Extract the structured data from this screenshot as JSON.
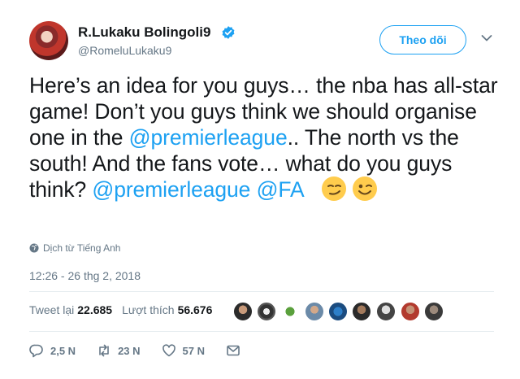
{
  "user": {
    "display_name": "R.Lukaku Bolingoli9",
    "handle": "@RomeluLukaku9",
    "verified": true
  },
  "follow_button_label": "Theo dõi",
  "tweet": {
    "segments": [
      {
        "text": "Here’s an idea for you guys… the nba has all-star game! Don’t you guys think we should organise one in the ",
        "type": "text"
      },
      {
        "text": "@premierleague",
        "type": "mention"
      },
      {
        "text": "..  The north vs the south! And the fans vote… what do you guys think? ",
        "type": "text"
      },
      {
        "text": "@premierleague",
        "type": "mention"
      },
      {
        "text": " ",
        "type": "text"
      },
      {
        "text": "@FA",
        "type": "mention"
      }
    ],
    "emojis": [
      "smirking-face-emoji",
      "winking-face-emoji"
    ]
  },
  "translate_label": "Dịch từ Tiếng Anh",
  "timestamp": "12:26 - 26 thg 2, 2018",
  "stats": {
    "retweets_label": "Tweet lại",
    "retweets_count": "22.685",
    "likes_label": "Lượt thích",
    "likes_count": "56.676"
  },
  "likers_count": 9,
  "actions": {
    "reply_count": "2,5 N",
    "retweet_count": "23 N",
    "like_count": "57 N"
  },
  "colors": {
    "accent": "#1da1f2",
    "text": "#14171a",
    "muted": "#657786",
    "divider": "#e6ecf0"
  }
}
